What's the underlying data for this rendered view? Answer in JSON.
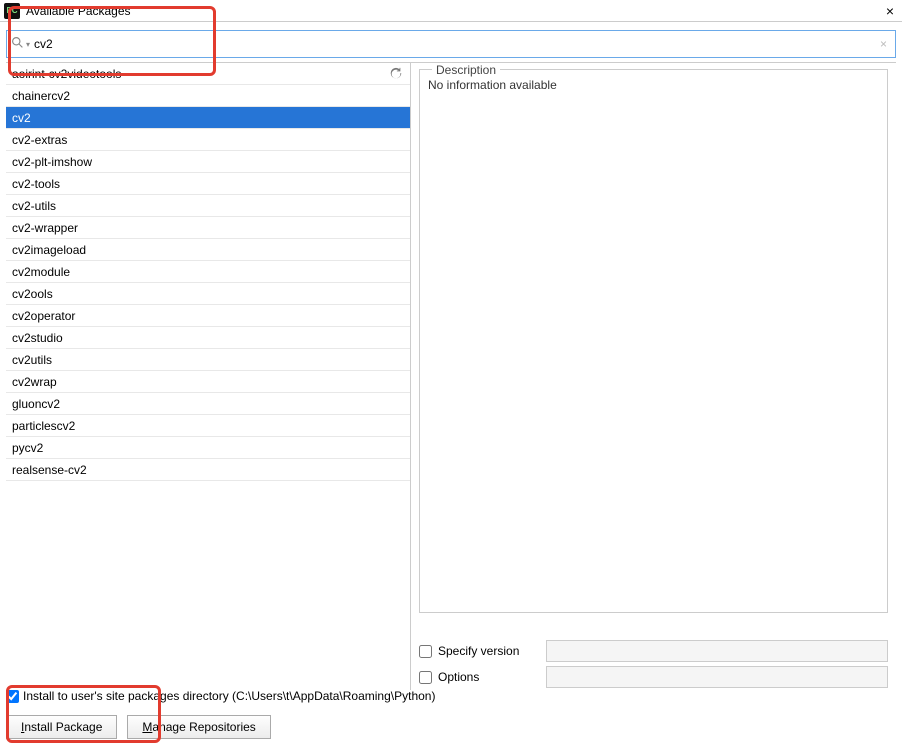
{
  "window": {
    "title": "Available Packages",
    "app_icon_label": "PC"
  },
  "search": {
    "value": "cv2",
    "placeholder": ""
  },
  "packages": [
    {
      "name": "aoirint-cv2videotools",
      "selected": false
    },
    {
      "name": "chainercv2",
      "selected": false
    },
    {
      "name": "cv2",
      "selected": true
    },
    {
      "name": "cv2-extras",
      "selected": false
    },
    {
      "name": "cv2-plt-imshow",
      "selected": false
    },
    {
      "name": "cv2-tools",
      "selected": false
    },
    {
      "name": "cv2-utils",
      "selected": false
    },
    {
      "name": "cv2-wrapper",
      "selected": false
    },
    {
      "name": "cv2imageload",
      "selected": false
    },
    {
      "name": "cv2module",
      "selected": false
    },
    {
      "name": "cv2ools",
      "selected": false
    },
    {
      "name": "cv2operator",
      "selected": false
    },
    {
      "name": "cv2studio",
      "selected": false
    },
    {
      "name": "cv2utils",
      "selected": false
    },
    {
      "name": "cv2wrap",
      "selected": false
    },
    {
      "name": "gluoncv2",
      "selected": false
    },
    {
      "name": "particlescv2",
      "selected": false
    },
    {
      "name": "pycv2",
      "selected": false
    },
    {
      "name": "realsense-cv2",
      "selected": false
    }
  ],
  "description": {
    "label": "Description",
    "text": "No information available"
  },
  "options": {
    "specify_version_label": "Specify version",
    "specify_version_checked": false,
    "options_label": "Options",
    "options_checked": false
  },
  "install_user_site": {
    "checked": true,
    "label": "Install to user's site packages directory (C:\\Users\\t\\AppData\\Roaming\\Python)"
  },
  "buttons": {
    "install": "Install Package",
    "manage": "Manage Repositories"
  }
}
